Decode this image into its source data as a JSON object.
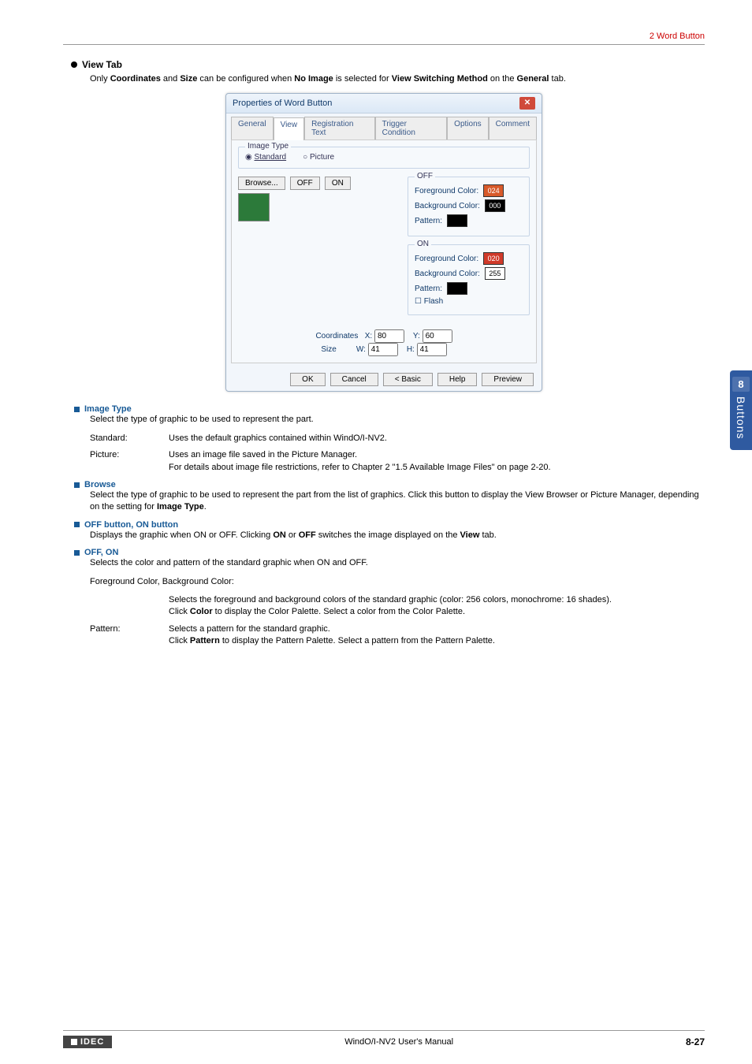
{
  "header": {
    "section": "2 Word Button"
  },
  "main": {
    "view_tab_label": "View",
    "view_tab_suffix": " Tab",
    "intro_parts": {
      "p1": "Only ",
      "p2": "Coordinates",
      "p3": " and ",
      "p4": "Size",
      "p5": " can be configured when ",
      "p6": "No Image",
      "p7": " is selected for ",
      "p8": "View Switching Method",
      "p9": " on the ",
      "p10": "General",
      "p11": " tab."
    }
  },
  "dialog": {
    "title": "Properties of Word Button",
    "tabs": [
      "General",
      "View",
      "Registration Text",
      "Trigger Condition",
      "Options",
      "Comment"
    ],
    "image_type_legend": "Image Type",
    "radio_standard": "Standard",
    "radio_picture": "Picture",
    "browse": "Browse...",
    "off_btn": "OFF",
    "on_btn": "ON",
    "off_legend": "OFF",
    "on_legend": "ON",
    "fg": "Foreground Color:",
    "bg": "Background Color:",
    "pattern": "Pattern:",
    "flash": "Flash",
    "off_fg_val": "024",
    "off_bg_val": "000",
    "on_fg_val": "020",
    "on_bg_val": "255",
    "coords_label": "Coordinates",
    "size_label": "Size",
    "x_label": "X:",
    "y_label": "Y:",
    "w_label": "W:",
    "h_label": "H:",
    "x": "80",
    "y": "60",
    "w": "41",
    "h": "41",
    "ok": "OK",
    "cancel": "Cancel",
    "basic": "< Basic",
    "help": "Help",
    "preview": "Preview"
  },
  "image_type": {
    "heading": "Image Type",
    "intro": "Select the type of graphic to be used to represent the part.",
    "std_term": "Standard:",
    "std_body": "Uses the default graphics contained within WindO/I-NV2.",
    "pic_term": "Picture:",
    "pic_body_l1": "Uses an image file saved in the Picture Manager.",
    "pic_body_l2": "For details about image file restrictions, refer to Chapter 2 \"1.5 Available Image Files\" on page 2-20."
  },
  "browse": {
    "heading": "Browse",
    "p1": "Select the type of graphic to be used to represent the part from the list of graphics. Click this button to display the View Browser or Picture Manager, depending on the setting for ",
    "p2": "Image Type",
    "p3": "."
  },
  "offon_button": {
    "heading": "OFF button, ON button",
    "p1": "Displays the graphic when ON or OFF. Clicking ",
    "p2": "ON",
    "p3": " or ",
    "p4": "OFF",
    "p5": " switches the image displayed on the ",
    "p6": "View",
    "p7": " tab."
  },
  "offon": {
    "heading": "OFF, ON",
    "intro": "Selects the color and pattern of the standard graphic when ON and OFF.",
    "fgbg_label": "Foreground Color, Background Color:",
    "fgbg_l1": "Selects the foreground and background colors of the standard graphic (color: 256 colors, monochrome: 16 shades).",
    "fgbg_l2a": "Click ",
    "fgbg_l2b": "Color",
    "fgbg_l2c": " to display the Color Palette. Select a color from the Color Palette.",
    "pat_term": "Pattern:",
    "pat_l1": "Selects a pattern for the standard graphic.",
    "pat_l2a": "Click ",
    "pat_l2b": "Pattern",
    "pat_l2c": " to display the Pattern Palette. Select a pattern from the Pattern Palette."
  },
  "side": {
    "num": "8",
    "text": "Buttons"
  },
  "footer": {
    "logo": "IDEC",
    "center": "WindO/I-NV2 User's Manual",
    "page": "8-27"
  }
}
